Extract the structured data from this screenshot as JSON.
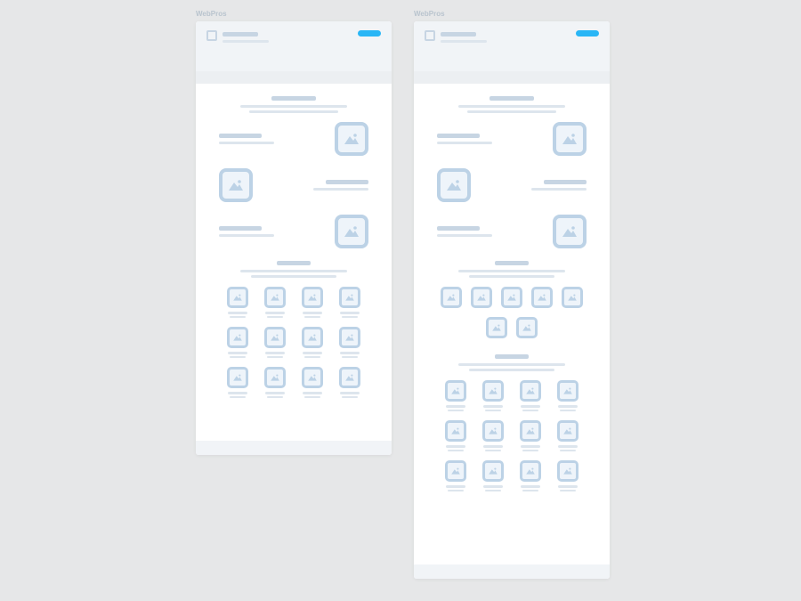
{
  "brand": "WebPros",
  "frames": [
    "a",
    "b"
  ],
  "features_count": 3,
  "grid_a_items": 12,
  "grid_b_top_items": 7,
  "grid_b_bottom_items": 12
}
